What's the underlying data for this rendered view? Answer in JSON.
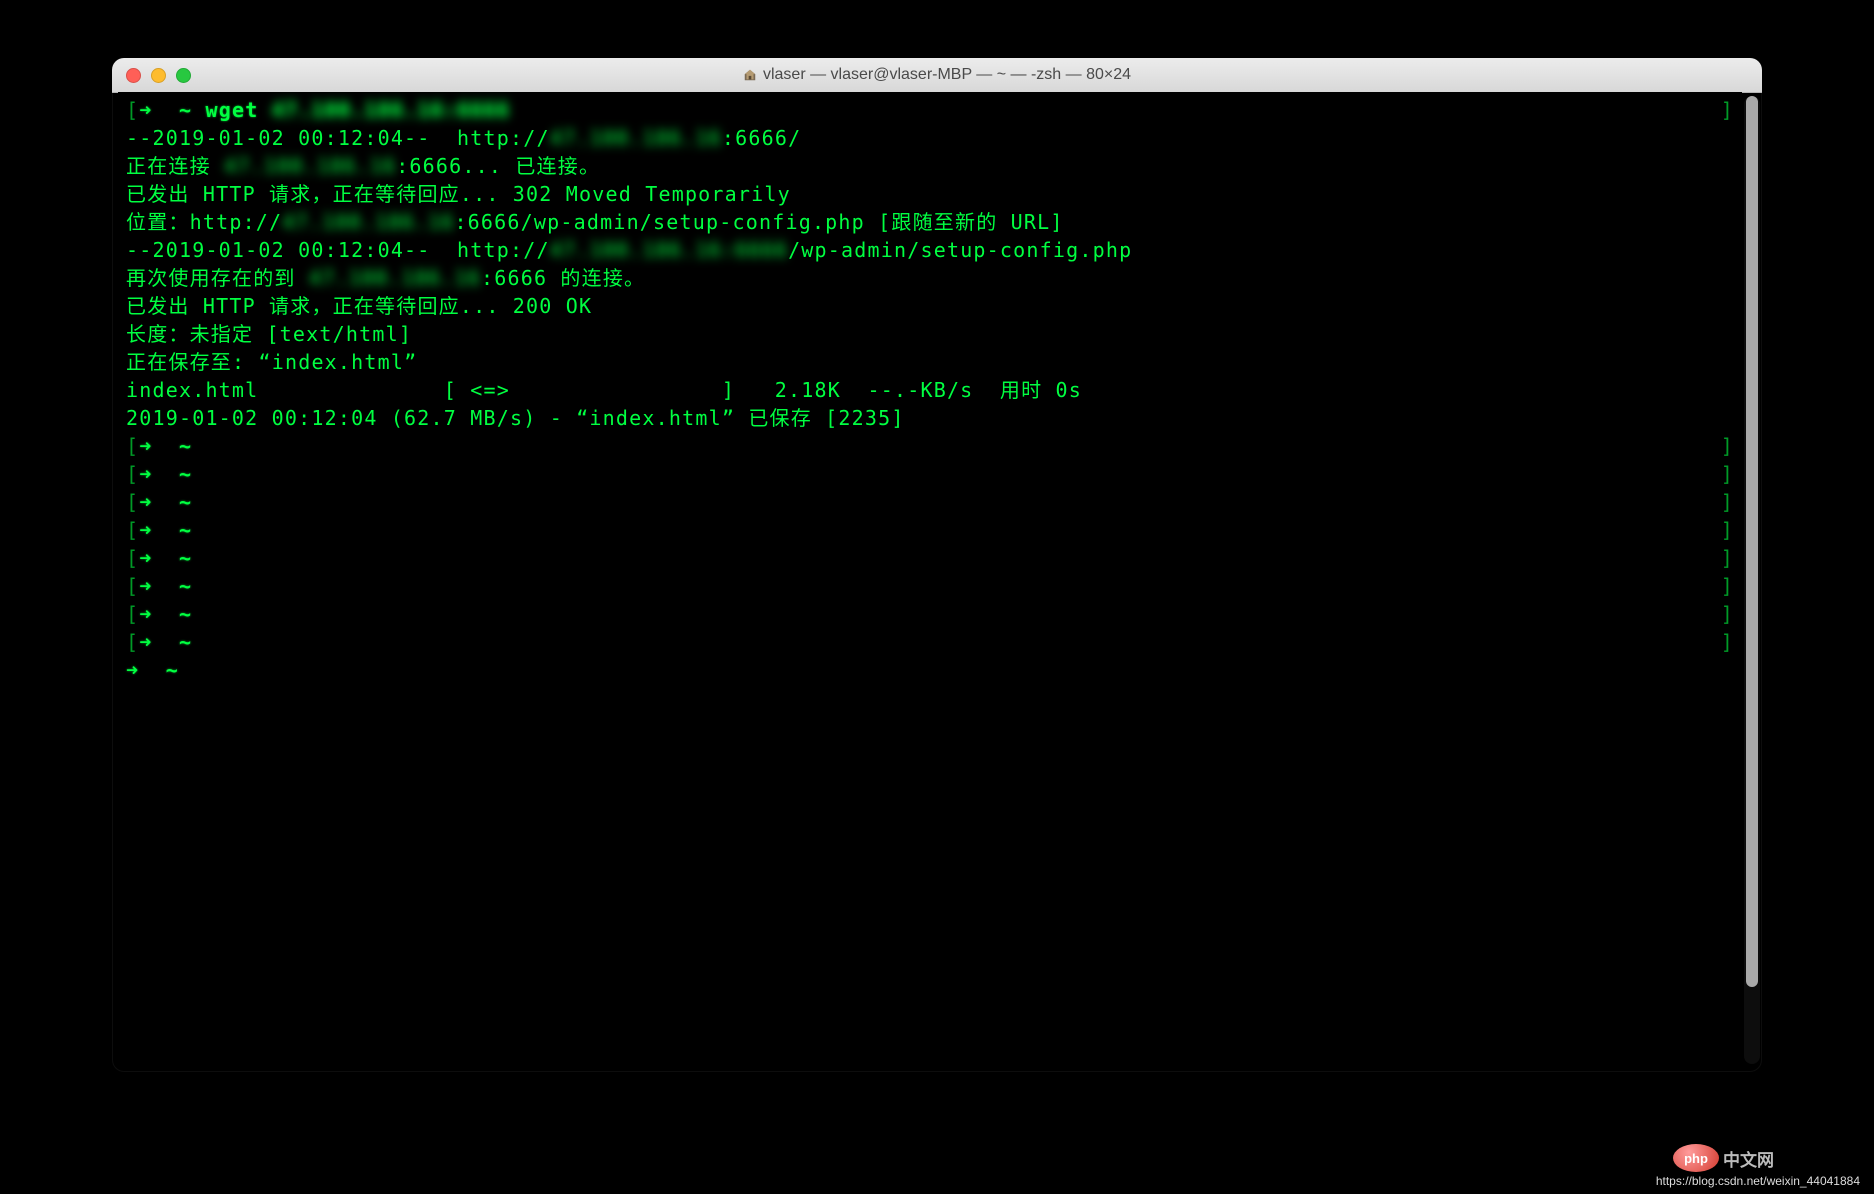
{
  "window": {
    "title": "vlaser — vlaser@vlaser-MBP — ~ — -zsh — 80×24"
  },
  "prompt": {
    "arrow": "➜",
    "tilde": "~"
  },
  "command": {
    "name": "wget",
    "host_blur": "47.100.186.16:6666"
  },
  "output": {
    "l1_a": "--2019-01-02 00:12:04--  http://",
    "l1_blur": "47.100.186.16",
    "l1_b": ":6666/",
    "l2_a": "正在连接 ",
    "l2_blur": "47.100.186.16",
    "l2_b": ":6666... 已连接。",
    "l3": "已发出 HTTP 请求，正在等待回应... 302 Moved Temporarily",
    "l4_a": "位置：http://",
    "l4_blur": "47.100.186.16",
    "l4_b": ":6666/wp-admin/setup-config.php [跟随至新的 URL]",
    "l5_a": "--2019-01-02 00:12:04--  http://",
    "l5_blur": "47.100.186.16:6666",
    "l5_b": "/wp-admin/setup-config.php",
    "l6_a": "再次使用存在的到 ",
    "l6_blur": "47.100.186.16",
    "l6_b": ":6666 的连接。",
    "l7": "已发出 HTTP 请求，正在等待回应... 200 OK",
    "l8": "长度：未指定 [text/html]",
    "l9": "正在保存至: “index.html”",
    "l10": "",
    "l11": "index.html              [ <=>                ]   2.18K  --.-KB/s  用时 0s",
    "l12": "",
    "l13": "2019-01-02 00:12:04 (62.7 MB/s) - “index.html” 已保存 [2235]",
    "l14": ""
  },
  "empty_prompts": 9,
  "brackets": {
    "left": "[",
    "right": "]"
  },
  "watermark": "https://blog.csdn.net/weixin_44041884",
  "badge": {
    "php": "php",
    "cn": "中文网"
  }
}
